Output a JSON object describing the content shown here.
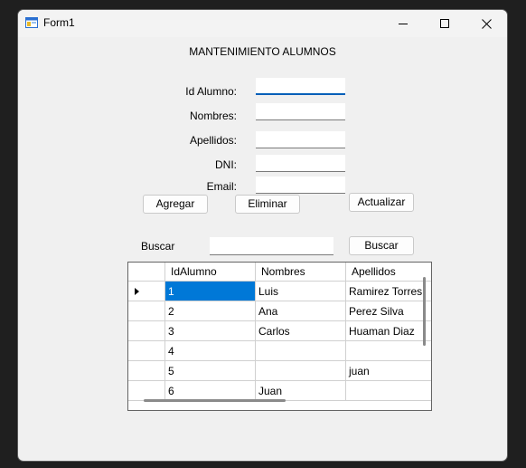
{
  "window": {
    "title": "Form1"
  },
  "form": {
    "heading": "MANTENIMIENTO ALUMNOS",
    "fields": [
      {
        "label": "Id Alumno:",
        "value": ""
      },
      {
        "label": "Nombres:",
        "value": ""
      },
      {
        "label": "Apellidos:",
        "value": ""
      },
      {
        "label": "DNI:",
        "value": ""
      },
      {
        "label": "Email:",
        "value": ""
      }
    ],
    "buttons": {
      "agregar": "Agregar",
      "eliminar": "Eliminar",
      "actualizar": "Actualizar"
    }
  },
  "search": {
    "label": "Buscar",
    "value": "",
    "button": "Buscar"
  },
  "grid": {
    "columns": [
      "IdAlumno",
      "Nombres",
      "Apellidos"
    ],
    "current_row": 1,
    "rows": [
      {
        "id": "1",
        "nombres": "Luis",
        "apellidos": "Ramirez Torres"
      },
      {
        "id": "2",
        "nombres": "Ana",
        "apellidos": "Perez Silva"
      },
      {
        "id": "3",
        "nombres": "Carlos",
        "apellidos": "Huaman Diaz"
      },
      {
        "id": "4",
        "nombres": "",
        "apellidos": ""
      },
      {
        "id": "5",
        "nombres": "",
        "apellidos": "juan"
      },
      {
        "id": "6",
        "nombres": "Juan",
        "apellidos": ""
      }
    ]
  },
  "colors": {
    "focus_accent": "#005fb8",
    "selection": "#0078d7"
  },
  "icons": [
    "form-app-icon",
    "minimize-icon",
    "maximize-icon",
    "close-icon",
    "current-row-arrow-icon"
  ]
}
